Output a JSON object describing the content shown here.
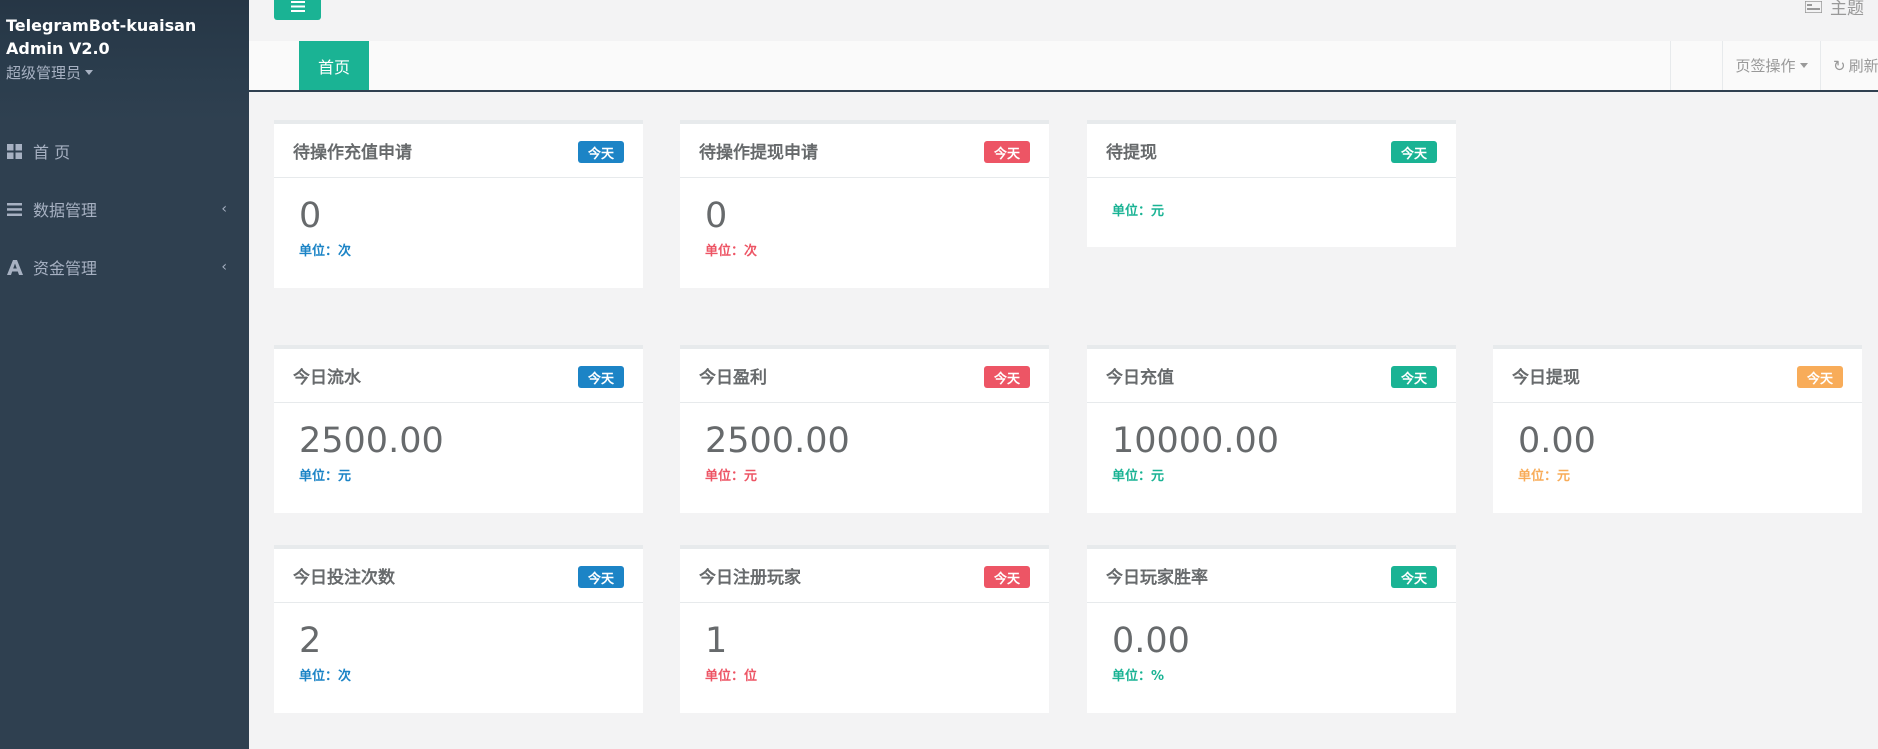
{
  "sidebar": {
    "brand_line1": "TelegramBot-kuaisan",
    "brand_line2": "Admin V2.0",
    "role": "超级管理员",
    "items": [
      {
        "label": "首 页",
        "icon": "grid-icon"
      },
      {
        "label": "数据管理",
        "icon": "list-icon"
      },
      {
        "label": "资金管理",
        "icon": "font-a-icon"
      }
    ]
  },
  "topbar": {
    "theme_label": "主题"
  },
  "tabs": {
    "active_label": "首页",
    "ops_label": "页签操作",
    "refresh_label": "刷新"
  },
  "cards": [
    {
      "title": "待操作充值申请",
      "badge": "今天",
      "value": "0",
      "unit": "单位：次",
      "color": "blue"
    },
    {
      "title": "待操作提现申请",
      "badge": "今天",
      "value": "0",
      "unit": "单位：次",
      "color": "red"
    },
    {
      "title": "待提现",
      "badge": "今天",
      "value": "",
      "unit": "单位：元",
      "color": "green"
    },
    {
      "title": "今日流水",
      "badge": "今天",
      "value": "2500.00",
      "unit": "单位：元",
      "color": "blue"
    },
    {
      "title": "今日盈利",
      "badge": "今天",
      "value": "2500.00",
      "unit": "单位：元",
      "color": "red"
    },
    {
      "title": "今日充值",
      "badge": "今天",
      "value": "10000.00",
      "unit": "单位：元",
      "color": "green"
    },
    {
      "title": "今日提现",
      "badge": "今天",
      "value": "0.00",
      "unit": "单位：元",
      "color": "orange"
    },
    {
      "title": "今日投注次数",
      "badge": "今天",
      "value": "2",
      "unit": "单位：次",
      "color": "blue"
    },
    {
      "title": "今日注册玩家",
      "badge": "今天",
      "value": "1",
      "unit": "单位：位",
      "color": "red"
    },
    {
      "title": "今日玩家胜率",
      "badge": "今天",
      "value": "0.00",
      "unit": "单位：%",
      "color": "green"
    }
  ],
  "colors": {
    "sidebar_bg": "#2f4050",
    "accent_green": "#1ab394",
    "blue": "#1c84c6",
    "red": "#ed5565",
    "orange": "#f8ac59"
  }
}
